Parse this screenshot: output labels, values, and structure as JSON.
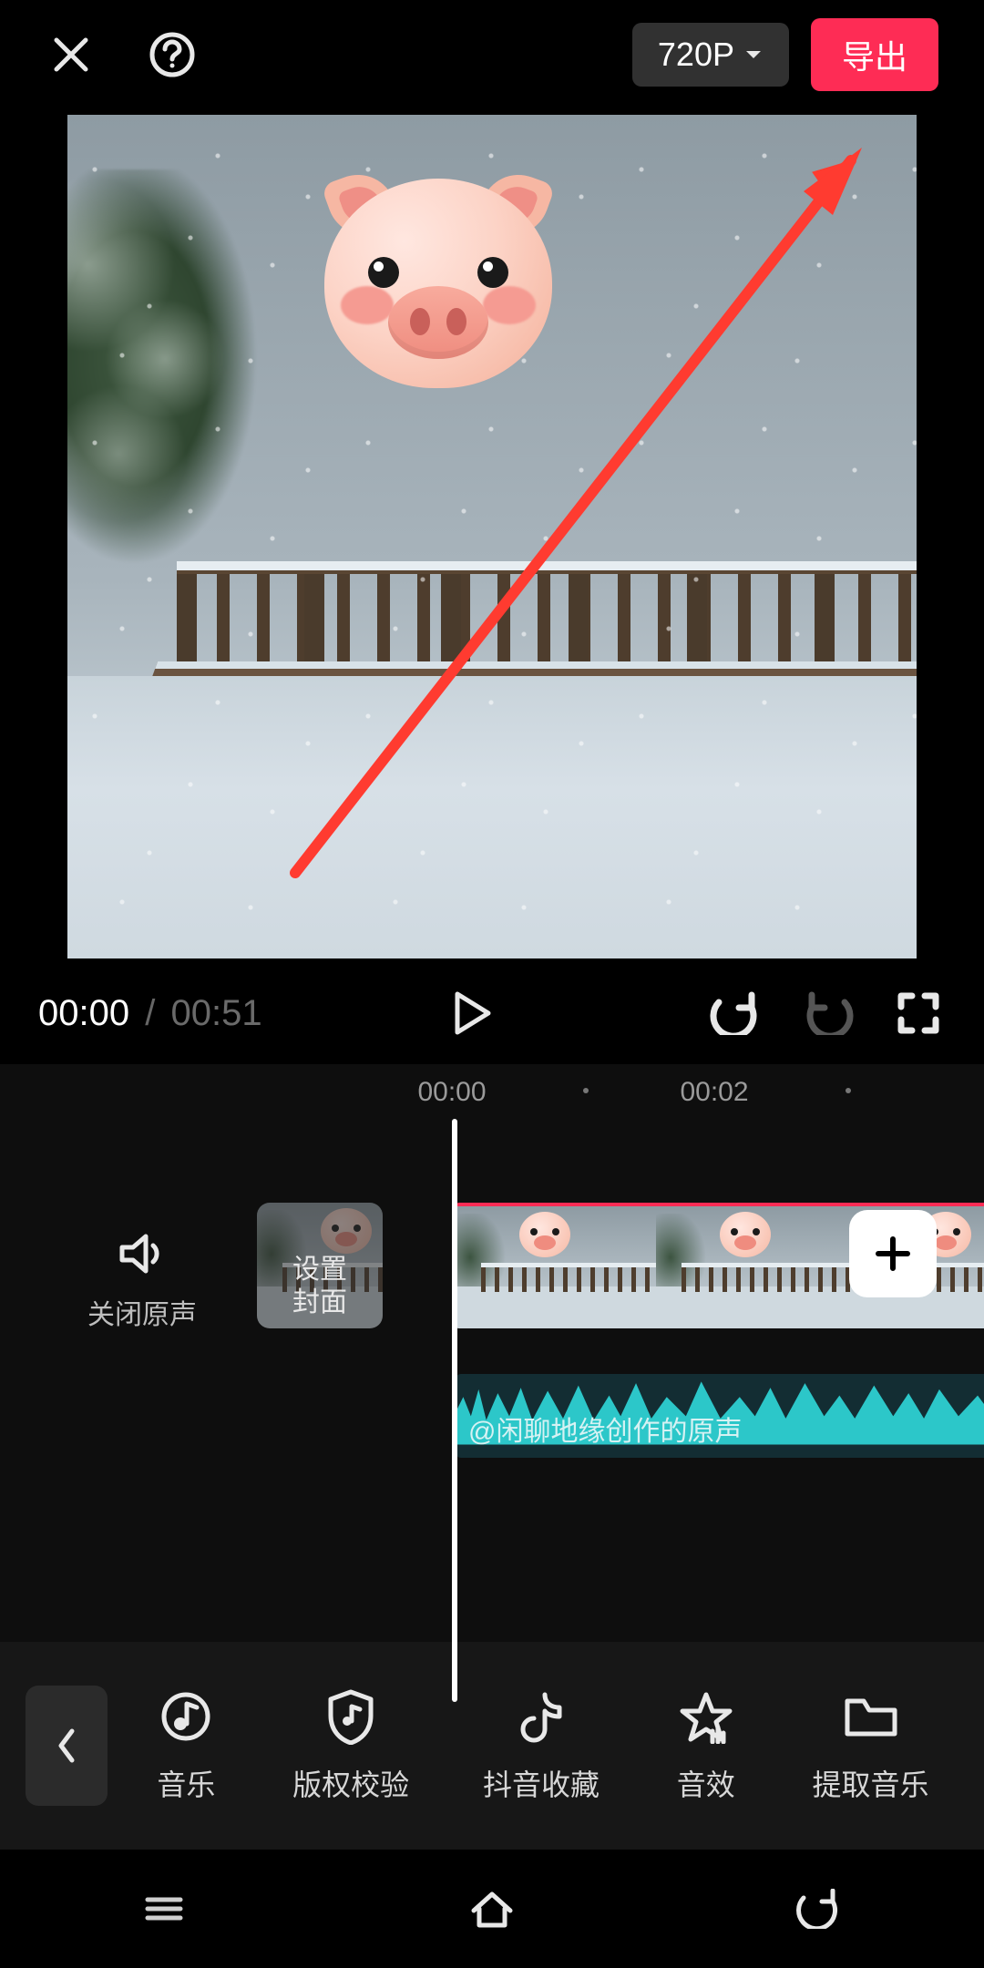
{
  "header": {
    "resolution_label": "720P",
    "export_label": "导出"
  },
  "player": {
    "current_time": "00:00",
    "separator": "/",
    "duration": "00:51"
  },
  "timeline": {
    "ruler": [
      "00:00",
      "00:02"
    ],
    "mute_label": "关闭原声",
    "cover_label_line1": "设置",
    "cover_label_line2": "封面",
    "audio_track_label": "@闲聊地缘创作的原声"
  },
  "toolbar": {
    "items": [
      {
        "id": "music",
        "label": "音乐"
      },
      {
        "id": "verify",
        "label": "版权校验"
      },
      {
        "id": "douyin",
        "label": "抖音收藏"
      },
      {
        "id": "sfx",
        "label": "音效"
      },
      {
        "id": "extract",
        "label": "提取音乐"
      }
    ]
  },
  "icons": {
    "close": "close-icon",
    "help": "help-icon",
    "play": "play-icon",
    "undo": "undo-icon",
    "redo": "redo-icon",
    "fullscreen": "fullscreen-icon",
    "speaker": "speaker-icon",
    "plus": "plus-icon",
    "back": "chevron-left-icon"
  },
  "colors": {
    "accent": "#fe2c55",
    "audio_wave": "#2cc7c9"
  }
}
